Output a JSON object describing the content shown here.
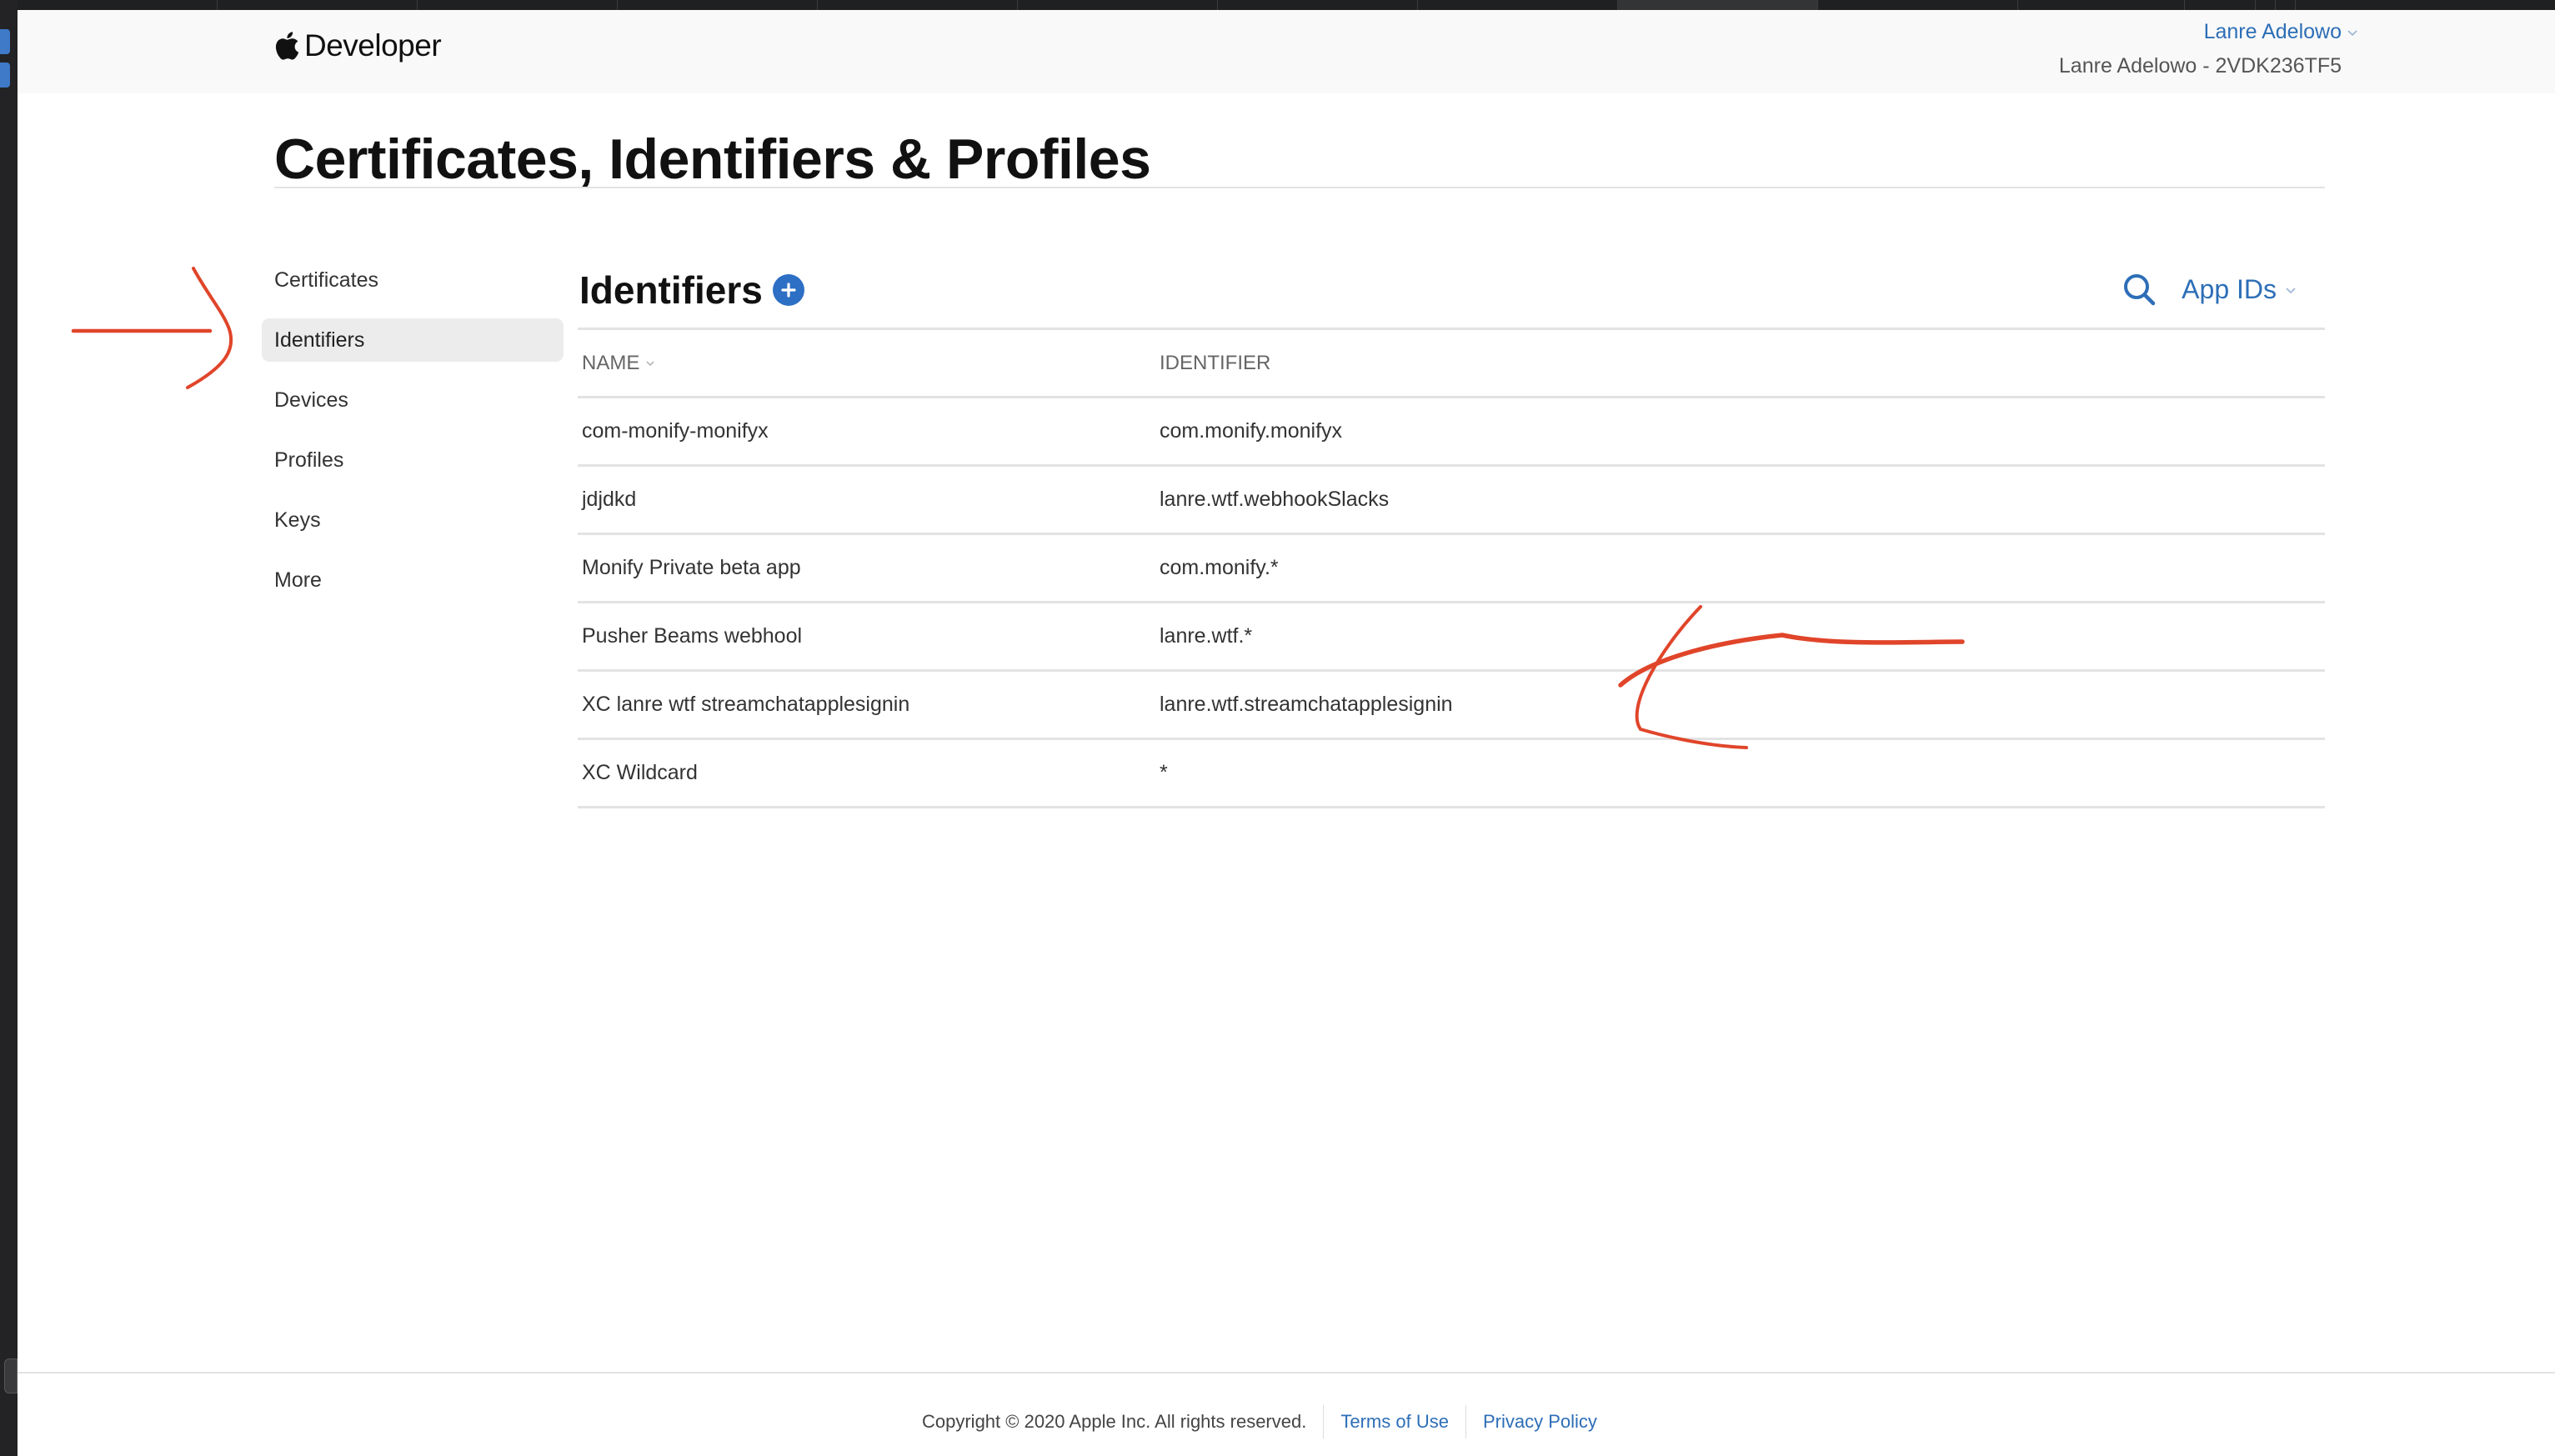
{
  "global_nav": {
    "brand": "Developer",
    "account_name": "Lanre Adelowo",
    "team_label": "Lanre Adelowo - 2VDK236TF5"
  },
  "page": {
    "title": "Certificates, Identifiers & Profiles"
  },
  "sidebar": {
    "items": [
      {
        "label": "Certificates",
        "active": false
      },
      {
        "label": "Identifiers",
        "active": true
      },
      {
        "label": "Devices",
        "active": false
      },
      {
        "label": "Profiles",
        "active": false
      },
      {
        "label": "Keys",
        "active": false
      },
      {
        "label": "More",
        "active": false
      }
    ]
  },
  "main": {
    "title": "Identifiers",
    "filter_label": "App IDs",
    "table": {
      "columns": [
        "NAME",
        "IDENTIFIER"
      ],
      "rows": [
        {
          "name": "com-monify-monifyx",
          "identifier": "com.monify.monifyx"
        },
        {
          "name": "jdjdkd",
          "identifier": "lanre.wtf.webhookSlacks"
        },
        {
          "name": "Monify Private beta app",
          "identifier": "com.monify.*"
        },
        {
          "name": "Pusher Beams webhool",
          "identifier": "lanre.wtf.*"
        },
        {
          "name": "XC lanre wtf streamchatapplesignin",
          "identifier": "lanre.wtf.streamchatapplesignin"
        },
        {
          "name": "XC Wildcard",
          "identifier": "*"
        }
      ]
    }
  },
  "footer": {
    "copyright": "Copyright © 2020 Apple Inc. All rights reserved.",
    "links": [
      "Terms of Use",
      "Privacy Policy"
    ]
  },
  "colors": {
    "link_blue": "#2d6eb7",
    "add_button_blue": "#2d6fc4",
    "annotation_red": "#e0452a"
  }
}
